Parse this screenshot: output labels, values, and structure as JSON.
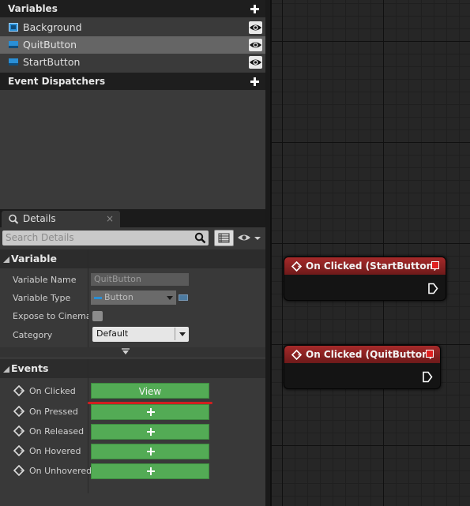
{
  "my_blueprint": {
    "variables_header": "Variables",
    "variables": [
      {
        "name": "Background",
        "selected": false,
        "type_color": "#2a8fd6"
      },
      {
        "name": "QuitButton",
        "selected": true,
        "type_color": "#2a8fd6"
      },
      {
        "name": "StartButton",
        "selected": false,
        "type_color": "#2a8fd6"
      }
    ],
    "event_dispatchers_header": "Event Dispatchers"
  },
  "details": {
    "tab_label": "Details",
    "tab_close": "×",
    "search_placeholder": "Search Details",
    "variable_section": {
      "title": "Variable",
      "variable_name_label": "Variable Name",
      "variable_name_value": "QuitButton",
      "variable_type_label": "Variable Type",
      "variable_type_value": "Button",
      "expose_label": "Expose to Cinemat",
      "expose_checked": false,
      "category_label": "Category",
      "category_value": "Default"
    },
    "events_section": {
      "title": "Events",
      "events": [
        {
          "label": "On Clicked",
          "button": "View"
        },
        {
          "label": "On Pressed",
          "button": ""
        },
        {
          "label": "On Released",
          "button": ""
        },
        {
          "label": "On Hovered",
          "button": ""
        },
        {
          "label": "On Unhovered",
          "button": ""
        }
      ]
    }
  },
  "graph": {
    "nodes": [
      {
        "title": "On Clicked (StartButton)"
      },
      {
        "title": "On Clicked (QuitButton)"
      }
    ]
  },
  "colors": {
    "event_button_green": "#53ab55",
    "event_node_header": "#a62a2a",
    "annotation_underline": "#d21f1f",
    "variable_type_blue": "#2a8fd6"
  }
}
